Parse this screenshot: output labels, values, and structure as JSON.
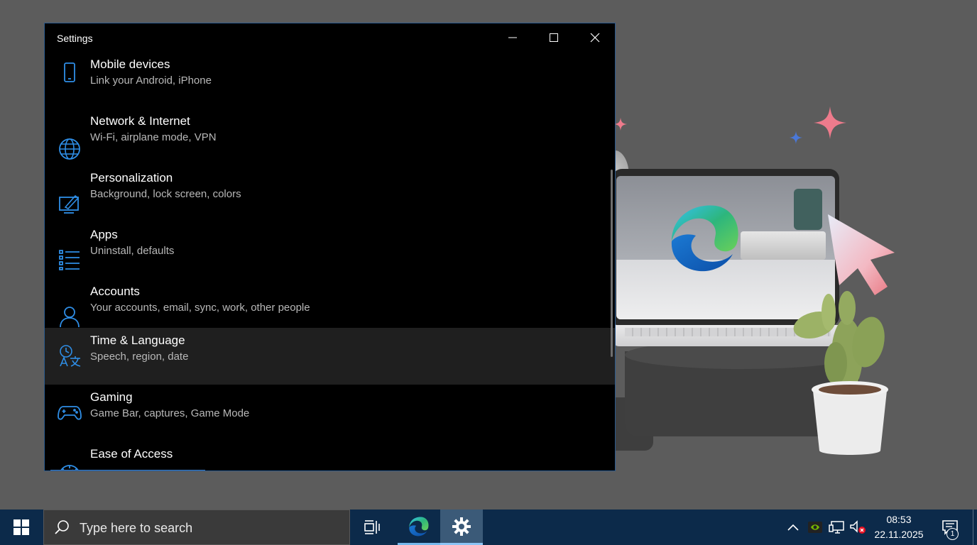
{
  "window": {
    "title": "Settings"
  },
  "categories": [
    {
      "title": "Mobile devices",
      "desc": "Link your Android, iPhone",
      "icon": "phone-icon"
    },
    {
      "title": "Network & Internet",
      "desc": "Wi-Fi, airplane mode, VPN",
      "icon": "globe-icon"
    },
    {
      "title": "Personalization",
      "desc": "Background, lock screen, colors",
      "icon": "personalization-icon"
    },
    {
      "title": "Apps",
      "desc": "Uninstall, defaults",
      "icon": "apps-list-icon"
    },
    {
      "title": "Accounts",
      "desc": "Your accounts, email, sync, work, other people",
      "icon": "person-icon"
    },
    {
      "title": "Time & Language",
      "desc": "Speech, region, date",
      "icon": "time-language-icon",
      "selected": true
    },
    {
      "title": "Gaming",
      "desc": "Game Bar, captures, Game Mode",
      "icon": "gamepad-icon"
    },
    {
      "title": "Ease of Access",
      "desc": "",
      "icon": "ease-of-access-icon"
    }
  ],
  "taskbar": {
    "search_placeholder": "Type here to search",
    "clock_time": "08:53",
    "clock_date": "22.11.2025",
    "notification_count": "1"
  },
  "colors": {
    "accent": "#2f8ee6",
    "taskbar": "#0c2a4a",
    "window_bg": "#000000",
    "selected_row": "#1f1f1f"
  }
}
